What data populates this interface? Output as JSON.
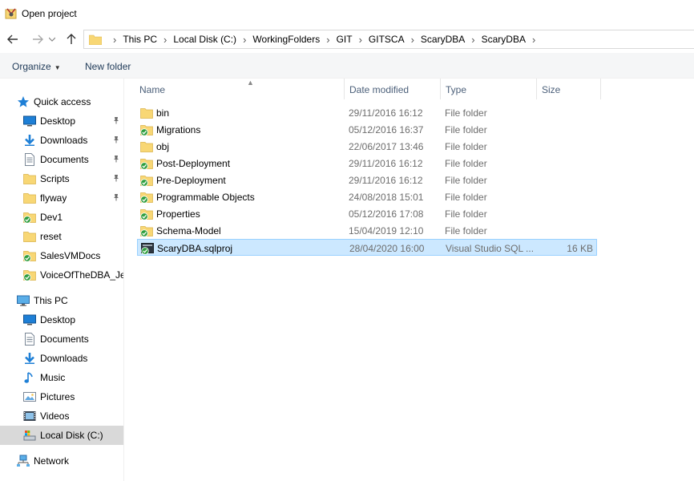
{
  "window": {
    "title": "Open project"
  },
  "nav": {
    "back_icon": "arrow-left-icon",
    "forward_icon": "arrow-right-icon",
    "recent_icon": "chevron-down-icon",
    "up_icon": "arrow-up-icon"
  },
  "address": {
    "crumbs": [
      "This PC",
      "Local Disk (C:)",
      "WorkingFolders",
      "GIT",
      "GITSCA",
      "ScaryDBA",
      "ScaryDBA"
    ]
  },
  "toolbar": {
    "organize_label": "Organize",
    "new_folder_label": "New folder"
  },
  "sidebar": {
    "quick_access_label": "Quick access",
    "items": [
      {
        "label": "Desktop",
        "icon": "desktop-icon",
        "pinned": true
      },
      {
        "label": "Downloads",
        "icon": "download-icon",
        "pinned": true
      },
      {
        "label": "Documents",
        "icon": "documents-icon",
        "pinned": true
      },
      {
        "label": "Scripts",
        "icon": "folder-icon",
        "pinned": true
      },
      {
        "label": "flyway",
        "icon": "folder-icon",
        "pinned": true
      },
      {
        "label": "Dev1",
        "icon": "folder-synced-icon",
        "pinned": false
      },
      {
        "label": "reset",
        "icon": "folder-icon",
        "pinned": false
      },
      {
        "label": "SalesVMDocs",
        "icon": "folder-synced-icon",
        "pinned": false
      },
      {
        "label": "VoiceOfTheDBA_Jer",
        "icon": "folder-synced-icon",
        "pinned": false
      }
    ],
    "this_pc_label": "This PC",
    "pc_items": [
      {
        "label": "Desktop",
        "icon": "desktop-icon"
      },
      {
        "label": "Documents",
        "icon": "documents-icon"
      },
      {
        "label": "Downloads",
        "icon": "download-icon"
      },
      {
        "label": "Music",
        "icon": "music-icon"
      },
      {
        "label": "Pictures",
        "icon": "pictures-icon"
      },
      {
        "label": "Videos",
        "icon": "videos-icon"
      },
      {
        "label": "Local Disk (C:)",
        "icon": "drive-icon"
      }
    ],
    "network_label": "Network"
  },
  "columns": {
    "name": "Name",
    "date": "Date modified",
    "type": "Type",
    "size": "Size"
  },
  "files": [
    {
      "name": "bin",
      "date": "29/11/2016 16:12",
      "type": "File folder",
      "size": "",
      "icon": "folder-icon"
    },
    {
      "name": "Migrations",
      "date": "05/12/2016 16:37",
      "type": "File folder",
      "size": "",
      "icon": "folder-synced-icon"
    },
    {
      "name": "obj",
      "date": "22/06/2017 13:46",
      "type": "File folder",
      "size": "",
      "icon": "folder-icon"
    },
    {
      "name": "Post-Deployment",
      "date": "29/11/2016 16:12",
      "type": "File folder",
      "size": "",
      "icon": "folder-synced-icon"
    },
    {
      "name": "Pre-Deployment",
      "date": "29/11/2016 16:12",
      "type": "File folder",
      "size": "",
      "icon": "folder-synced-icon"
    },
    {
      "name": "Programmable Objects",
      "date": "24/08/2018 15:01",
      "type": "File folder",
      "size": "",
      "icon": "folder-synced-icon"
    },
    {
      "name": "Properties",
      "date": "05/12/2016 17:08",
      "type": "File folder",
      "size": "",
      "icon": "folder-synced-icon"
    },
    {
      "name": "Schema-Model",
      "date": "15/04/2019 12:10",
      "type": "File folder",
      "size": "",
      "icon": "folder-synced-icon"
    },
    {
      "name": "ScaryDBA.sqlproj",
      "date": "28/04/2020 16:00",
      "type": "Visual Studio SQL ...",
      "size": "16 KB",
      "icon": "sqlproj-file-icon"
    }
  ],
  "colors": {
    "folder": "#f8d775",
    "sync_green": "#2e9e3e",
    "selection": "#cce8ff",
    "selection_border": "#99d1ff",
    "accent": "#0078d7"
  }
}
